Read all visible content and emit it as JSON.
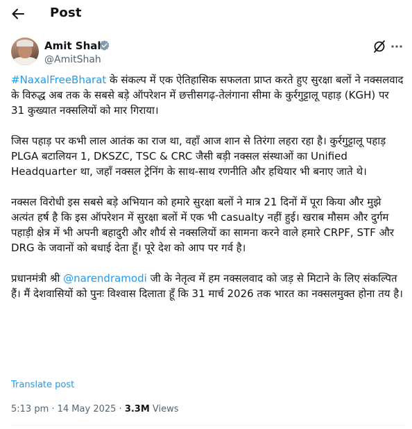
{
  "header": {
    "title": "Post",
    "back_icon": "arrow-left-icon"
  },
  "author": {
    "name": "Amit Shah",
    "handle": "@AmitShah",
    "verified_icon": "verified-badge-icon",
    "verified_color": "#829aab"
  },
  "actions": {
    "grok_icon": "grok-icon",
    "more_icon": "more-horizontal-icon"
  },
  "post": {
    "p1_hashtag": "#NaxalFreeBharat",
    "p1_text": " के संकल्प में एक ऐतिहासिक सफलता प्राप्त करते हुए सुरक्षा बलों ने नक्सलवाद के विरुद्ध अब तक के सबसे बड़े ऑपरेशन में छत्तीसगढ़-तेलंगाना सीमा के कुर्रगुट्टालू पहाड़ (KGH) पर 31 कुख्यात नक्सलियों को मार गिराया।",
    "p2_text": "जिस पहाड़ पर कभी लाल आतंक का राज था, वहाँ आज शान से तिरंगा लहरा रहा है। कुर्रगुट्टालू पहाड़ PLGA बटालियन 1, DKSZC, TSC & CRC जैसी बड़ी नक्सल संस्थाओं का Unified Headquarter था, जहाँ नक्सल ट्रेनिंग के साथ-साथ रणनीति और हथियार भी बनाए जाते थे।",
    "p3_text": "नक्सल विरोधी इस सबसे बड़े अभियान को हमारे सुरक्षा बलों ने मात्र 21 दिनों में पूरा किया और मुझे अत्यंत हर्ष है कि इस ऑपरेशन में सुरक्षा बलों में एक भी casualty नहीं हुई। खराब मौसम और दुर्गम पहाड़ी क्षेत्र में भी अपनी बहादुरी और शौर्य से नक्सलियों का सामना करने वाले हमारे CRPF, STF और DRG के जवानों को बधाई देता हूँ। पूरे देश को आप पर गर्व है।",
    "p4_before": "प्रधानमंत्री श्री ",
    "p4_mention": "@narendramodi",
    "p4_after": " जी के नेतृत्व में हम नक्सलवाद को जड़ से मिटाने के लिए संकल्पित हैं। मैं देशवासियों को पुनः विश्वास दिलाता हूँ कि 31 मार्च 2026 तक भारत का नक्सलमुक्त होना तय है।"
  },
  "translate_label": "Translate post",
  "meta": {
    "time_date": "5:13 pm · 14 May 2025 · ",
    "views_count": "3.3M",
    "views_label": " Views"
  },
  "colors": {
    "link": "#1d9bf0",
    "secondary_text": "#536471",
    "primary_text": "#0f1419"
  }
}
